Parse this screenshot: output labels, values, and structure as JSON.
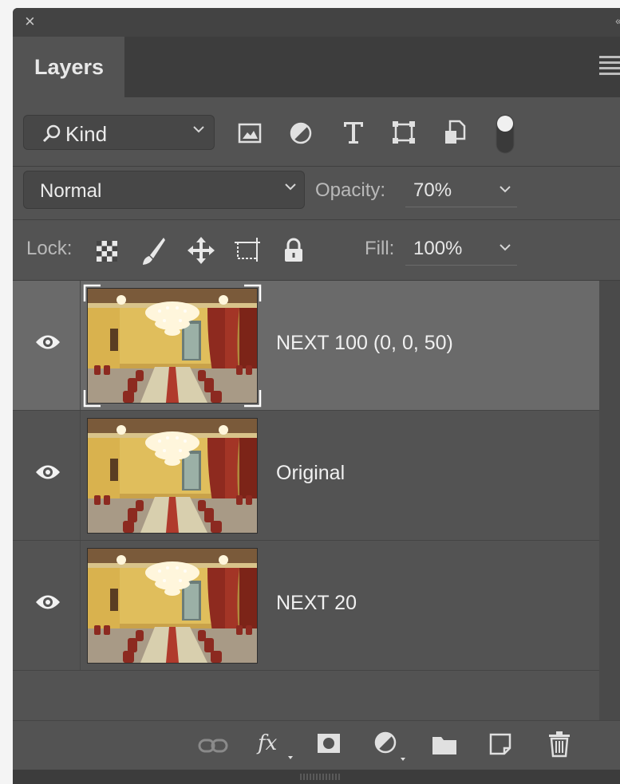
{
  "panel": {
    "tab_label": "Layers"
  },
  "filter": {
    "kind_label": "Kind",
    "icons": [
      "image-filter-icon",
      "adjustment-filter-icon",
      "type-filter-icon",
      "shape-filter-icon",
      "smart-object-filter-icon",
      "filter-toggle-icon"
    ]
  },
  "blend": {
    "mode": "Normal",
    "opacity_label": "Opacity:",
    "opacity_value": "70%"
  },
  "lock": {
    "label": "Lock:",
    "icons": [
      "lock-transparent-pixels-icon",
      "lock-image-pixels-icon",
      "lock-position-icon",
      "lock-artboard-icon",
      "lock-all-icon"
    ],
    "fill_label": "Fill:",
    "fill_value": "100%"
  },
  "layers": [
    {
      "name": "NEXT 100 (0, 0, 50)",
      "visible": true,
      "selected": true
    },
    {
      "name": "Original",
      "visible": true,
      "selected": false
    },
    {
      "name": "NEXT 20",
      "visible": true,
      "selected": false
    }
  ],
  "bottom_bar": {
    "icons": [
      "link-layers-icon",
      "fx-icon",
      "add-mask-icon",
      "new-adjustment-layer-icon",
      "new-group-icon",
      "new-layer-icon",
      "delete-layer-icon"
    ]
  },
  "colors": {
    "panel_bg": "#535353",
    "selected_row": "#6a6a6a",
    "tab_bar": "#3d3d3d"
  }
}
